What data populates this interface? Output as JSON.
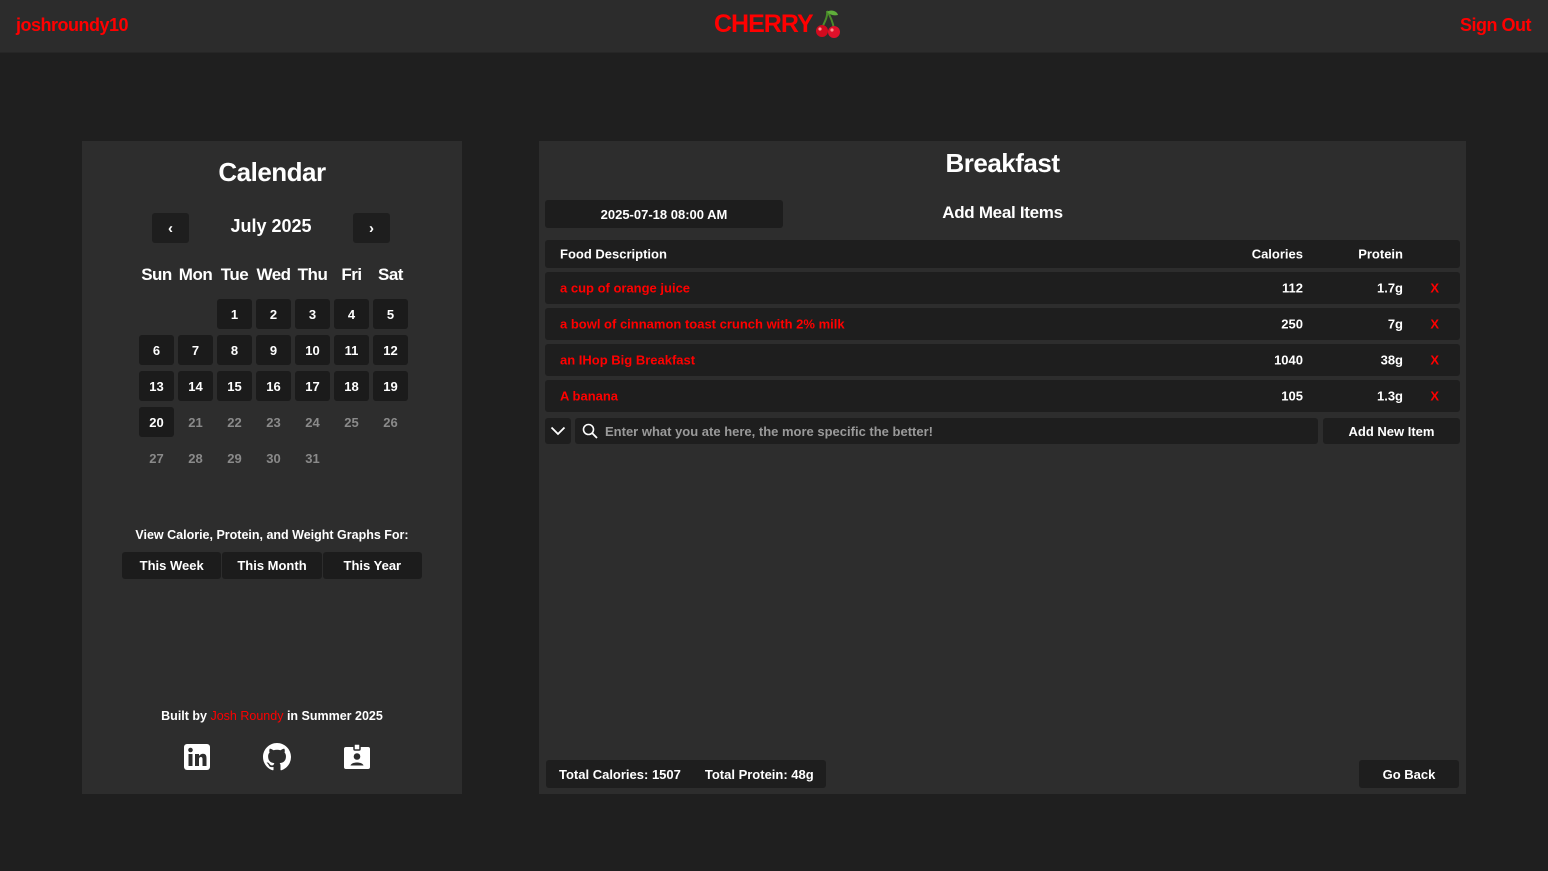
{
  "header": {
    "username": "joshroundy10",
    "brand": "CHERRY",
    "sign_out": "Sign Out"
  },
  "calendar": {
    "title": "Calendar",
    "month_label": "July 2025",
    "prev_glyph": "‹",
    "next_glyph": "›",
    "weekdays": [
      "Sun",
      "Mon",
      "Tue",
      "Wed",
      "Thu",
      "Fri",
      "Sat"
    ],
    "days": [
      "",
      "",
      "1",
      "2",
      "3",
      "4",
      "5",
      "6",
      "7",
      "8",
      "9",
      "10",
      "11",
      "12",
      "13",
      "14",
      "15",
      "16",
      "17",
      "18",
      "19",
      "20",
      "21",
      "22",
      "23",
      "24",
      "25",
      "26",
      "27",
      "28",
      "29",
      "30",
      "31"
    ],
    "today": "20",
    "graphs_label": "View Calorie, Protein, and Weight Graphs For:",
    "graph_buttons": [
      "This Week",
      "This Month",
      "This Year"
    ],
    "built_by_prefix": "Built by",
    "built_by_name": "Josh Roundy",
    "built_by_suffix": "in Summer 2025",
    "social_icons": [
      "linkedin-icon",
      "github-icon",
      "contact-card-icon"
    ]
  },
  "meal": {
    "title": "Breakfast",
    "datetime": "2025-07-18  08:00 AM",
    "add_items_label": "Add Meal Items",
    "columns": {
      "description": "Food Description",
      "calories": "Calories",
      "protein": "Protein"
    },
    "items": [
      {
        "description": "a cup of orange juice",
        "calories": "112",
        "protein": "1.7g",
        "remove": "X"
      },
      {
        "description": "a bowl of cinnamon toast crunch with 2% milk",
        "calories": "250",
        "protein": "7g",
        "remove": "X"
      },
      {
        "description": "an IHop Big Breakfast",
        "calories": "1040",
        "protein": "38g",
        "remove": "X"
      },
      {
        "description": "A banana",
        "calories": "105",
        "protein": "1.3g",
        "remove": "X"
      }
    ],
    "search_placeholder": "Enter what you ate here, the more specific the better!",
    "add_new_item": "Add New Item",
    "total_calories": "Total Calories: 1507",
    "total_protein": "Total Protein: 48g",
    "go_back": "Go Back"
  },
  "colors": {
    "accent": "#ff0000",
    "background": "#1f1f1f",
    "panel": "#2d2d2d",
    "control": "#1e1e1e"
  }
}
